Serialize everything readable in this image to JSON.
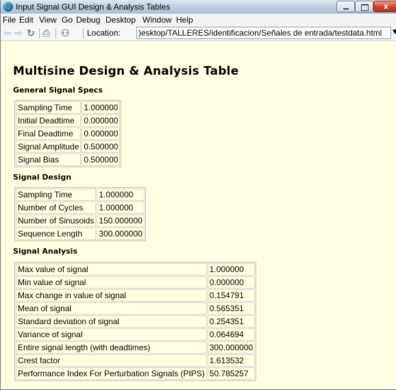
{
  "window": {
    "title": "Input Signal GUI Design & Analysis Tables"
  },
  "menu": [
    "File",
    "Edit",
    "View",
    "Go",
    "Debug",
    "Desktop",
    "Window",
    "Help"
  ],
  "toolbar": {
    "location_label": "Location:",
    "location_value": ")esktop/TALLERES/identificacion/Señales de entrada/testdata.html"
  },
  "page": {
    "title": "Multisine Design & Analysis Table",
    "sections": [
      {
        "heading": "General Signal Specs",
        "rows": [
          [
            "Sampling Time",
            "1.000000"
          ],
          [
            "Initial Deadtime",
            "0.000000"
          ],
          [
            "Final Deadtime",
            "0.000000"
          ],
          [
            "Signal Amplitude",
            "0.500000"
          ],
          [
            "Signal Bias",
            "0.500000"
          ]
        ]
      },
      {
        "heading": "Signal Design",
        "rows": [
          [
            "Sampling Time",
            "1.000000"
          ],
          [
            "Number of Cycles",
            "1.000000"
          ],
          [
            "Number of Sinusoids",
            "150.000000"
          ],
          [
            "Sequence Length",
            "300.000000"
          ]
        ]
      },
      {
        "heading": "Signal Analysis",
        "rows": [
          [
            "Max value of signal",
            "1.000000"
          ],
          [
            "Min value of signal",
            "0.000000"
          ],
          [
            "Max change in value of signal",
            "0.154791"
          ],
          [
            "Mean of signal",
            "0.565351"
          ],
          [
            "Standard deviation of signal",
            "0.254351"
          ],
          [
            "Variance of signal",
            "0.064694"
          ],
          [
            "Entire signal length (with deadtimes)",
            "300.000000"
          ],
          [
            "Crest factor",
            "1.613532"
          ],
          [
            "Performance Index For Perturbation Signals (PIPS)",
            "50.785257"
          ]
        ]
      }
    ]
  }
}
